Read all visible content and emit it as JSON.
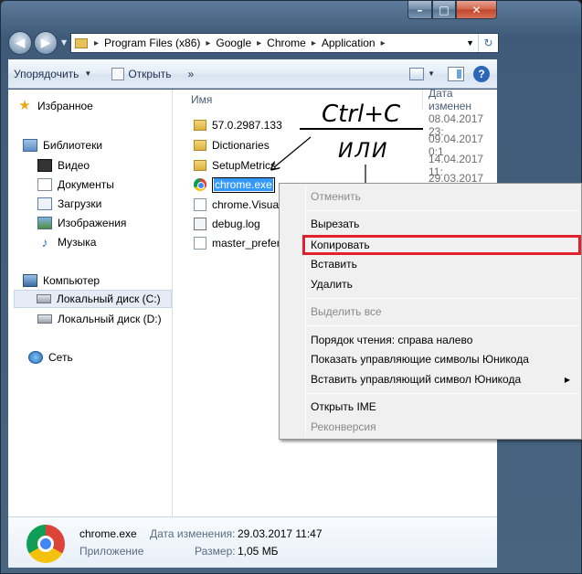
{
  "window": {
    "caption": {
      "minimize": "–",
      "maximize": "□",
      "close": "✕"
    }
  },
  "address": {
    "crumbs": [
      "Program Files (x86)",
      "Google",
      "Chrome",
      "Application"
    ],
    "separator": "▸"
  },
  "toolbar": {
    "organize": "Упорядочить",
    "open": "Открыть",
    "more": "»"
  },
  "sidebar": {
    "favorites": "Избранное",
    "libraries": "Библиотеки",
    "video": "Видео",
    "documents": "Документы",
    "downloads": "Загрузки",
    "images": "Изображения",
    "music": "Музыка",
    "computer": "Компьютер",
    "disk_c": "Локальный диск (C:)",
    "disk_d": "Локальный диск (D:)",
    "network": "Сеть"
  },
  "columns": {
    "name": "Имя",
    "date": "Дата изменен"
  },
  "files": [
    {
      "name": "57.0.2987.133",
      "date": "08.04.2017 23:",
      "icon": "folder-icon"
    },
    {
      "name": "Dictionaries",
      "date": "09.04.2017 0:1",
      "icon": "folder-icon"
    },
    {
      "name": "SetupMetrics",
      "date": "14.04.2017 11:",
      "icon": "folder-icon"
    },
    {
      "name": "chrome.exe",
      "date": "29.03.2017 11:",
      "icon": "chrome-icon"
    },
    {
      "name": "chrome.Visual",
      "date": "",
      "icon": "file-icon"
    },
    {
      "name": "debug.log",
      "date": "",
      "icon": "log-icon"
    },
    {
      "name": "master_prefere",
      "date": "",
      "icon": "file-icon"
    }
  ],
  "details": {
    "filename": "chrome.exe",
    "type": "Приложение",
    "modified_label": "Дата изменения:",
    "modified_value": "29.03.2017 11:47",
    "size_label": "Размер:",
    "size_value": "1,05 МБ"
  },
  "context_menu": {
    "undo": "Отменить",
    "cut": "Вырезать",
    "copy": "Копировать",
    "paste": "Вставить",
    "delete": "Удалить",
    "select_all": "Выделить все",
    "rtl": "Порядок чтения: справа налево",
    "show_unicode": "Показать управляющие символы Юникода",
    "insert_unicode": "Вставить управляющий символ Юникода",
    "open_ime": "Открыть IME",
    "reconversion": "Реконверсия"
  },
  "annotation": {
    "shortcut": "Ctrl+C",
    "or": "ИЛИ"
  },
  "colors": {
    "highlight_box": "#e1222c",
    "selection": "#3399ff"
  }
}
